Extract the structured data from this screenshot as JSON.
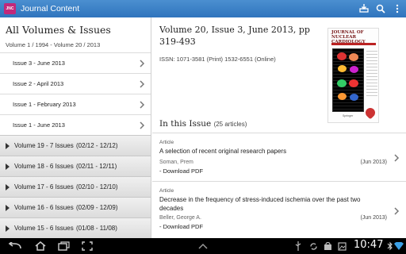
{
  "app": {
    "icon_text": "JNC",
    "title": "Journal Content"
  },
  "left_panel": {
    "title": "All Volumes & Issues",
    "range": "Volume 1 / 1994 - Volume 20 / 2013",
    "issues": [
      {
        "label": "Issue 3 - June 2013"
      },
      {
        "label": "Issue 2 - April 2013"
      },
      {
        "label": "Issue 1 - February 2013"
      },
      {
        "label": "Issue 1 - June 2013"
      }
    ],
    "volumes": [
      {
        "label": "Volume 19 - 7 Issues",
        "dates": "(02/12  -  12/12)"
      },
      {
        "label": "Volume 18 - 6 Issues",
        "dates": "(02/11  -  12/11)"
      },
      {
        "label": "Volume 17 - 6 Issues",
        "dates": "(02/10  -  12/10)"
      },
      {
        "label": "Volume 16 - 6 Issues",
        "dates": "(02/09  -  12/09)"
      },
      {
        "label": "Volume 15 - 6 Issues",
        "dates": "(01/08  -  11/08)"
      }
    ]
  },
  "main": {
    "heading": "Volume 20, Issue 3, June 2013, pp 319-493",
    "issn": "ISSN: 1071-3581 (Print) 1532-6551 (Online)",
    "cover": {
      "title_line1": "JOURNAL OF",
      "title_line2": "NUCLEAR CARDIOLOGY",
      "publisher": "Springer"
    },
    "in_issue_label": "In this Issue",
    "in_issue_count": "(25 articles)",
    "articles": [
      {
        "type": "Article",
        "title": "A selection of recent original research papers",
        "authors": "Soman, Prem",
        "date": "(Jun 2013)",
        "download": "- Download PDF"
      },
      {
        "type": "Article",
        "title": "Decrease in the frequency of stress-induced ischemia over the past two decades",
        "authors": "Beller, George A.",
        "date": "(Jun 2013)",
        "download": "- Download PDF"
      }
    ]
  },
  "system_bar": {
    "time": "10:47"
  },
  "colors": {
    "action_bar": "#3a80c6",
    "app_icon": "#c2287a",
    "system_bar": "#000000"
  }
}
